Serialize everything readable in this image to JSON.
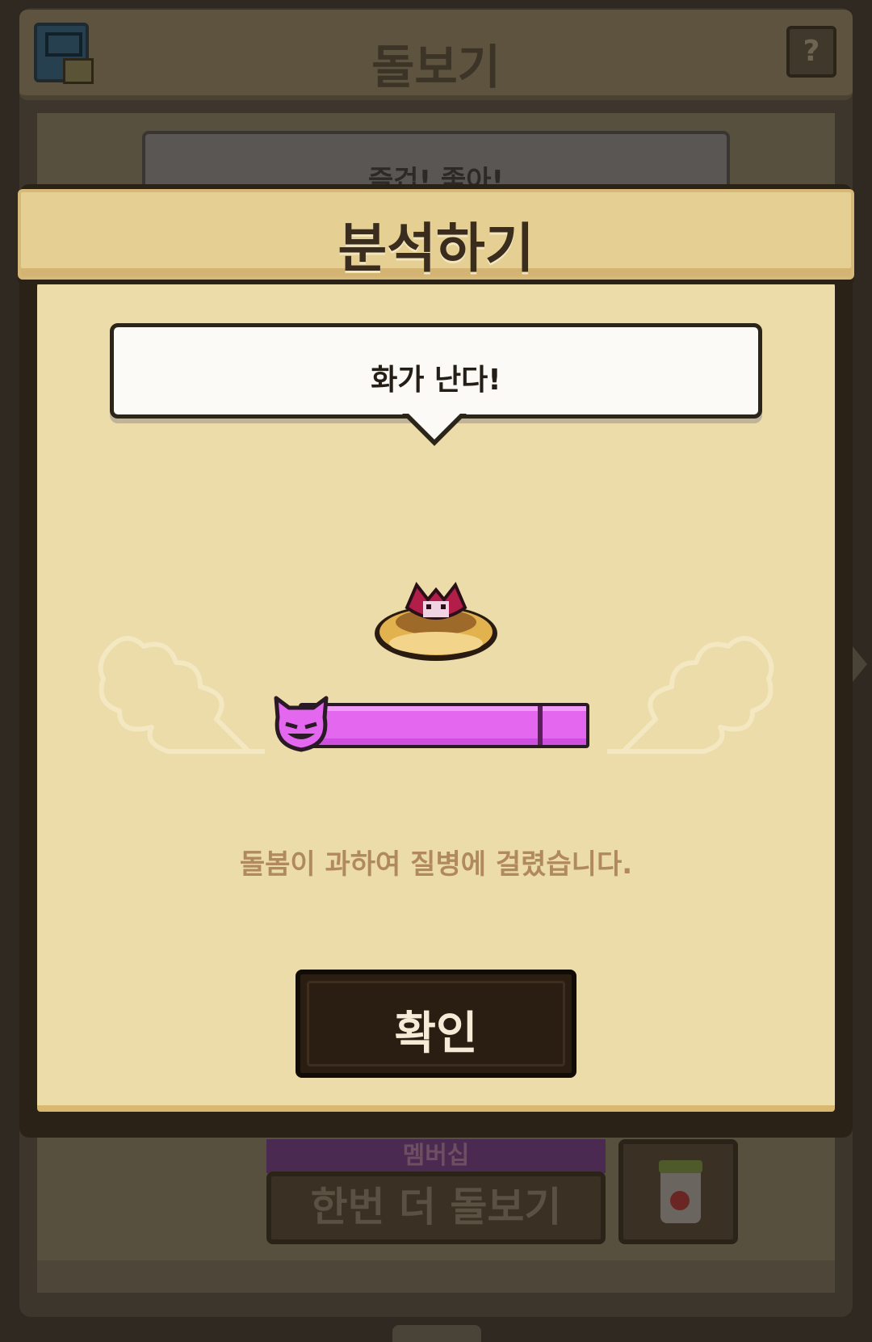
{
  "background": {
    "title": "돌보기",
    "help_label": "?",
    "speech_text": "즐겁! 좋아!",
    "membership_label": "멤버십",
    "again_button_label": "한번 더 돌보기"
  },
  "modal": {
    "title": "분석하기",
    "speech_text": "화가 난다!",
    "mood": {
      "icon": "devil-face-icon",
      "fill_fraction": 1.0,
      "color": "#e467f0"
    },
    "message": "돌봄이 과하여 질병에 걸렸습니다.",
    "confirm_label": "확인"
  }
}
